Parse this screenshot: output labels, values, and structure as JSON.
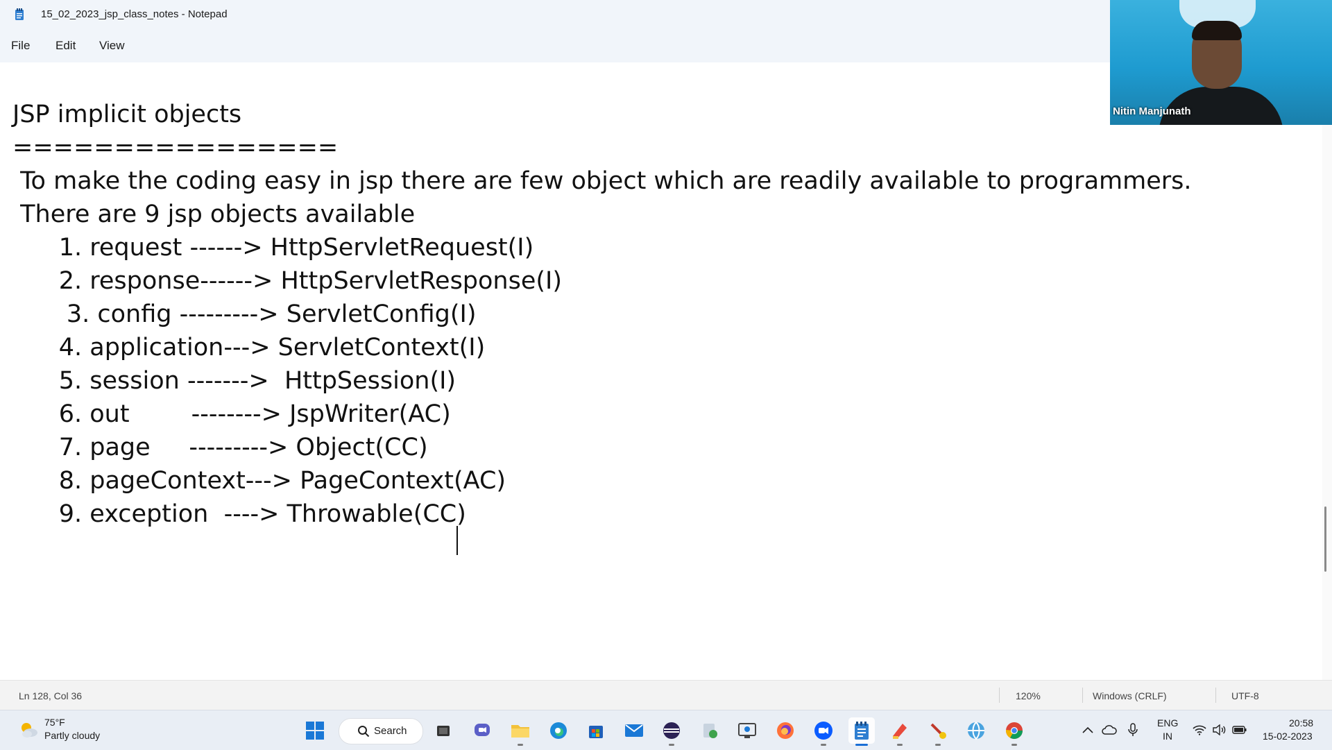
{
  "window": {
    "title": "15_02_2023_jsp_class_notes - Notepad"
  },
  "menu": {
    "file": "File",
    "edit": "Edit",
    "view": "View"
  },
  "document": {
    "lines": [
      "JSP implicit objects",
      "================",
      " To make the coding easy in jsp there are few object which are readily available to programmers.",
      " There are 9 jsp objects available",
      "      1. request ------> HttpServletRequest(I)",
      "      2. response------> HttpServletResponse(I)",
      "       3. config ---------> ServletConfig(I)",
      "      4. application---> ServletContext(I)",
      "      5. session ------->  HttpSession(I)",
      "      6. out        --------> JspWriter(AC)",
      "      7. page     ---------> Object(CC)",
      "      8. pageContext---> PageContext(AC)",
      "      9. exception  ----> Throwable(CC)"
    ]
  },
  "webcam": {
    "participant_name": "Nitin Manjunath"
  },
  "status": {
    "position": "Ln 128, Col 36",
    "zoom": "120%",
    "line_ending": "Windows (CRLF)",
    "encoding": "UTF-8"
  },
  "taskbar": {
    "weather_temp": "75°F",
    "weather_desc": "Partly cloudy",
    "search_label": "Search",
    "language_top": "ENG",
    "language_bottom": "IN",
    "time": "20:58",
    "date": "15-02-2023",
    "apps": [
      "start-icon",
      "task-view-icon",
      "chat-icon",
      "file-explorer-icon",
      "edge-icon",
      "store-icon",
      "mail-icon",
      "eclipse-icon",
      "settings-app-icon",
      "snipping-icon",
      "firefox-icon",
      "zoom-icon",
      "notepad-icon",
      "paint-icon",
      "tool-icon",
      "network-app-icon",
      "chrome-icon"
    ]
  },
  "colors": {
    "accent": "#1a6fd6",
    "title_bar_bg": "#f1f5fa",
    "taskbar_bg": "#e9eef5"
  }
}
